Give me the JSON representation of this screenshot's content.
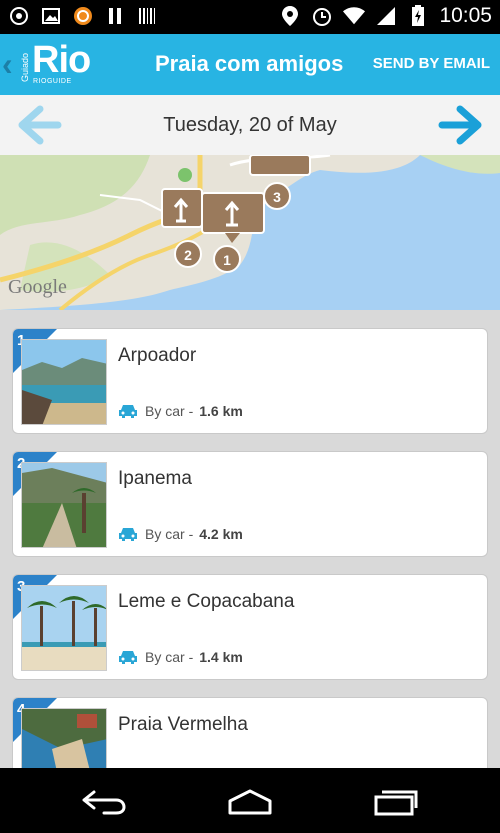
{
  "status_bar": {
    "time": "10:05",
    "left_icons": [
      "camera-icon",
      "image-icon",
      "app-icon",
      "pause-icon",
      "barcode-icon"
    ],
    "right_icons": [
      "location-icon",
      "alarm-icon",
      "wifi-icon",
      "signal-icon",
      "battery-icon"
    ]
  },
  "app_bar": {
    "logo_text": "Rio",
    "logo_vertical": "Guiado",
    "logo_subtext": "RIOGUIDE",
    "title": "Praia com amigos",
    "send_email_label": "SEND BY EMAIL"
  },
  "date_bar": {
    "date": "Tuesday, 20 of May"
  },
  "map": {
    "attribution": "Google",
    "marker_numbers": [
      "1",
      "2",
      "3"
    ]
  },
  "places": [
    {
      "number": "1",
      "name": "Arpoador",
      "mode": "By car -",
      "distance": "1.6 km"
    },
    {
      "number": "2",
      "name": "Ipanema",
      "mode": "By car -",
      "distance": "4.2 km"
    },
    {
      "number": "3",
      "name": "Leme e Copacabana",
      "mode": "By car -",
      "distance": "1.4 km"
    },
    {
      "number": "4",
      "name": "Praia Vermelha",
      "mode": "",
      "distance": ""
    }
  ],
  "colors": {
    "accent": "#28b4e3",
    "badge": "#2c82c9",
    "map_marker": "#9a7a5c"
  }
}
